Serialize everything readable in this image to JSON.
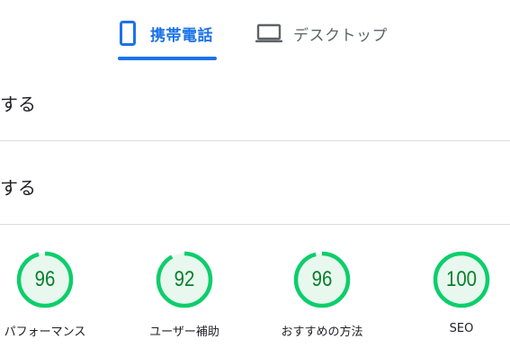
{
  "tabs": [
    {
      "label": "携帯電話",
      "icon": "smartphone-icon",
      "active": true
    },
    {
      "label": "デスクトップ",
      "icon": "laptop-icon",
      "active": false
    }
  ],
  "rows": [
    {
      "text": "する"
    },
    {
      "text": "する"
    }
  ],
  "scores": [
    {
      "value": "96",
      "score": 96,
      "label": "パフォーマンス"
    },
    {
      "value": "92",
      "score": 92,
      "label": "ユーザー補助"
    },
    {
      "value": "96",
      "score": 96,
      "label": "おすすめの方法"
    },
    {
      "value": "100",
      "score": 100,
      "label": "SEO"
    }
  ],
  "colors": {
    "accent": "#1a73e8",
    "inactive": "#5f6368",
    "score_pass": "#0cce6b",
    "score_pass_bg": "#e8f8ee",
    "score_text": "#0a7d2c",
    "divider": "#dadce0"
  }
}
